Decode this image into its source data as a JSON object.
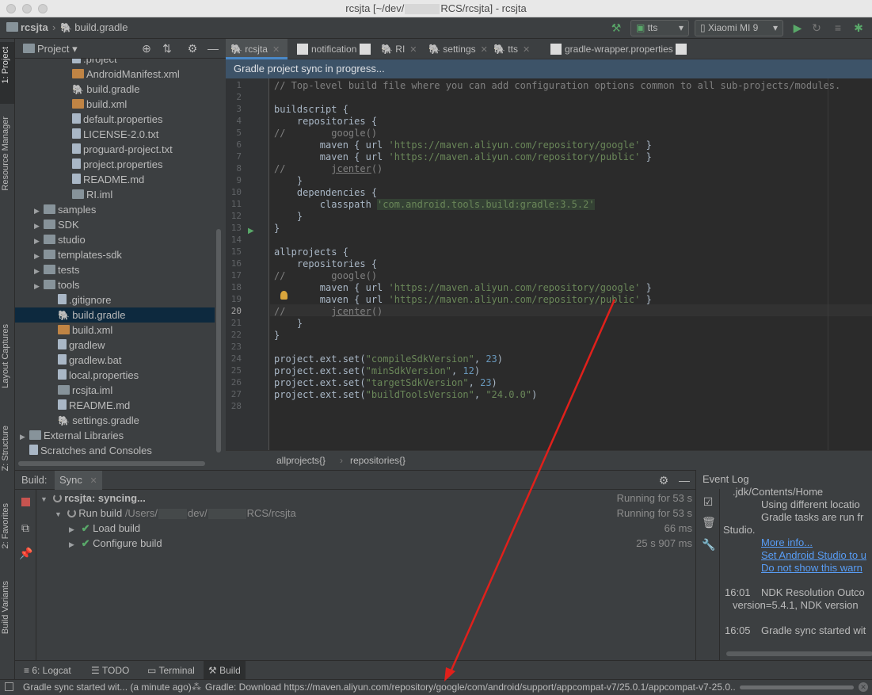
{
  "window": {
    "title_prefix": "rcsjta [~/dev/",
    "title_suffix": "RCS/rcsjta] - rcsjta"
  },
  "navbar": {
    "project": "rcsjta",
    "file": "build.gradle",
    "run_config": "tts",
    "device": "Xiaomi MI 9"
  },
  "left_strip": {
    "project": "1: Project",
    "resource_manager": "Resource Manager",
    "layout_captures": "Layout Captures",
    "structure": "Z: Structure",
    "favorites": "2: Favorites",
    "build_variants": "Build Variants"
  },
  "project_panel": {
    "title": "Project",
    "items": [
      {
        "label": ".project",
        "icon": "file-icon",
        "indent": 3
      },
      {
        "label": "AndroidManifest.xml",
        "icon": "xml-icon",
        "indent": 3
      },
      {
        "label": "build.gradle",
        "icon": "gradle-icon",
        "indent": 3
      },
      {
        "label": "build.xml",
        "icon": "xml-icon",
        "indent": 3
      },
      {
        "label": "default.properties",
        "icon": "properties-icon",
        "indent": 3
      },
      {
        "label": "LICENSE-2.0.txt",
        "icon": "text-icon",
        "indent": 3
      },
      {
        "label": "proguard-project.txt",
        "icon": "text-icon",
        "indent": 3
      },
      {
        "label": "project.properties",
        "icon": "properties-icon",
        "indent": 3
      },
      {
        "label": "README.md",
        "icon": "text-icon",
        "indent": 3
      },
      {
        "label": "RI.iml",
        "icon": "module-icon",
        "indent": 3
      },
      {
        "label": "samples",
        "icon": "folder-icon",
        "indent": 1,
        "arrow": true
      },
      {
        "label": "SDK",
        "icon": "folder-icon",
        "indent": 1,
        "arrow": true
      },
      {
        "label": "studio",
        "icon": "folder-icon",
        "indent": 1,
        "arrow": true
      },
      {
        "label": "templates-sdk",
        "icon": "folder-icon",
        "indent": 1,
        "arrow": true
      },
      {
        "label": "tests",
        "icon": "folder-icon",
        "indent": 1,
        "arrow": true
      },
      {
        "label": "tools",
        "icon": "folder-icon",
        "indent": 1,
        "arrow": true
      },
      {
        "label": ".gitignore",
        "icon": "text-icon",
        "indent": 2
      },
      {
        "label": "build.gradle",
        "icon": "gradle-icon",
        "indent": 2,
        "selected": true
      },
      {
        "label": "build.xml",
        "icon": "xml-icon",
        "indent": 2
      },
      {
        "label": "gradlew",
        "icon": "text-icon",
        "indent": 2
      },
      {
        "label": "gradlew.bat",
        "icon": "text-icon",
        "indent": 2
      },
      {
        "label": "local.properties",
        "icon": "properties-icon",
        "indent": 2
      },
      {
        "label": "rcsjta.iml",
        "icon": "module-icon",
        "indent": 2
      },
      {
        "label": "README.md",
        "icon": "text-icon",
        "indent": 2
      },
      {
        "label": "settings.gradle",
        "icon": "gradle-icon",
        "indent": 2
      },
      {
        "label": "External Libraries",
        "icon": "library-icon",
        "indent": 0,
        "arrow": true
      },
      {
        "label": "Scratches and Consoles",
        "icon": "scratch-icon",
        "indent": 0
      }
    ]
  },
  "editor": {
    "tabs": [
      {
        "label": "rcsjta",
        "active": true
      },
      {
        "label": "notification"
      },
      {
        "label": "RI"
      },
      {
        "label": "settings"
      },
      {
        "label": "tts"
      },
      {
        "label": "gradle-wrapper.properties"
      }
    ],
    "banner": "Gradle project sync in progress...",
    "line_count": 28,
    "current_line": 20,
    "breadcrumbs": [
      "allprojects{}",
      "repositories{}"
    ]
  },
  "build_panel": {
    "label": "Build:",
    "tab": "Sync",
    "rows": [
      {
        "text": "rcsjta: syncing...",
        "time": "Running for 53 s"
      },
      {
        "text": "Run build",
        "path_prefix": "/Users/",
        "path_mid": "dev/",
        "path_suffix": "RCS/rcsjta",
        "time": "Running for 53 s"
      },
      {
        "text": "Load build",
        "time": "66 ms"
      },
      {
        "text": "Configure build",
        "time": "25 s 907 ms"
      }
    ]
  },
  "event_log": {
    "title": "Event Log",
    "lines": [
      ".jdk/Contents/Home",
      "Using different locatio",
      "Gradle tasks are run fr",
      "Studio."
    ],
    "links": [
      "More info...",
      "Set Android Studio to u",
      "Do not show this warn"
    ],
    "entries": [
      {
        "time": "16:01",
        "text": "NDK Resolution Outco",
        "detail": "version=5.4.1, NDK version"
      },
      {
        "time": "16:05",
        "text": "Gradle sync started wit"
      }
    ]
  },
  "bottom_tabs": [
    {
      "label": "6: Logcat"
    },
    {
      "label": "TODO"
    },
    {
      "label": "Terminal"
    },
    {
      "label": "Build",
      "active": true
    }
  ],
  "status": {
    "left": "Gradle sync started wit... (a minute ago)",
    "progress": "Gradle: Download https://maven.aliyun.com/repository/google/com/android/support/appcompat-v7/25.0.1/appcompat-v7-25.0...."
  },
  "colors": {
    "accent": "#4a88c7",
    "arrow": "#e0201b",
    "selection": "#0d293e",
    "banner": "#3d5368"
  }
}
